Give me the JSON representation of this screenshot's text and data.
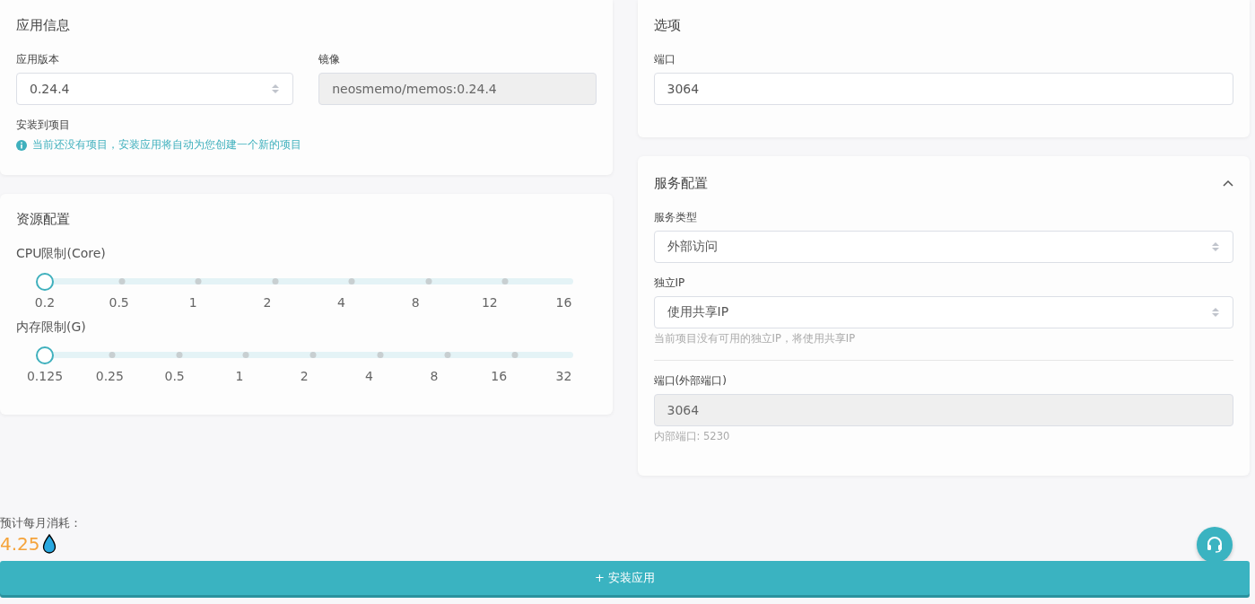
{
  "app_info": {
    "title": "应用信息",
    "version": {
      "label": "应用版本",
      "value": "0.24.4"
    },
    "image": {
      "label": "镜像",
      "value": "neosmemo/memos:0.24.4"
    },
    "project": {
      "label": "安装到项目",
      "notice": "当前还没有项目，安装应用将自动为您创建一个新的项目"
    }
  },
  "resources": {
    "title": "资源配置",
    "sliders": [
      {
        "label": "CPU限制(Core)",
        "level": 0,
        "ticks": [
          "0.2",
          "0.5",
          "1",
          "2",
          "4",
          "8",
          "12",
          "16"
        ]
      },
      {
        "label": "内存限制(G)",
        "level": 0,
        "ticks": [
          "0.125",
          "0.25",
          "0.5",
          "1",
          "2",
          "4",
          "8",
          "16",
          "32"
        ]
      }
    ]
  },
  "options": {
    "title": "选项",
    "port": {
      "label": "端口",
      "value": "3064"
    }
  },
  "service": {
    "title": "服务配置",
    "expanded": true,
    "type": {
      "label": "服务类型",
      "value": "外部访问"
    },
    "ip": {
      "label": "独立IP",
      "value": "使用共享IP",
      "hint": "当前项目没有可用的独立IP，将使用共享IP"
    },
    "external_port": {
      "label": "端口(外部端口)",
      "value": "3064",
      "hint": "内部端口: 5230"
    }
  },
  "cost": {
    "label": "预计每月消耗：",
    "value": "4.25"
  },
  "install_button": {
    "icon": "+",
    "label": "安装应用"
  }
}
